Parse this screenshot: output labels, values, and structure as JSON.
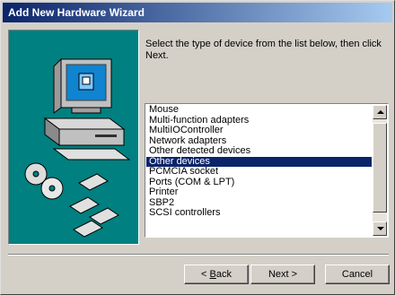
{
  "window": {
    "title": "Add New Hardware Wizard"
  },
  "instruction": "Select the type of device from the list below, then click Next.",
  "device_list": {
    "items": [
      "Mouse",
      "Multi-function adapters",
      "MultiIOController",
      "Network adapters",
      "Other detected devices",
      "Other devices",
      "PCMCIA socket",
      "Ports (COM & LPT)",
      "Printer",
      "SBP2",
      "SCSI controllers"
    ],
    "selected": "Other devices"
  },
  "buttons": {
    "back_prefix": "< ",
    "back_key": "B",
    "back_rest": "ack",
    "next": "Next >",
    "cancel": "Cancel"
  },
  "colors": {
    "art_bg": "#008080",
    "title_start": "#0a246a",
    "title_end": "#a6caf0",
    "selection": "#0a246a"
  }
}
